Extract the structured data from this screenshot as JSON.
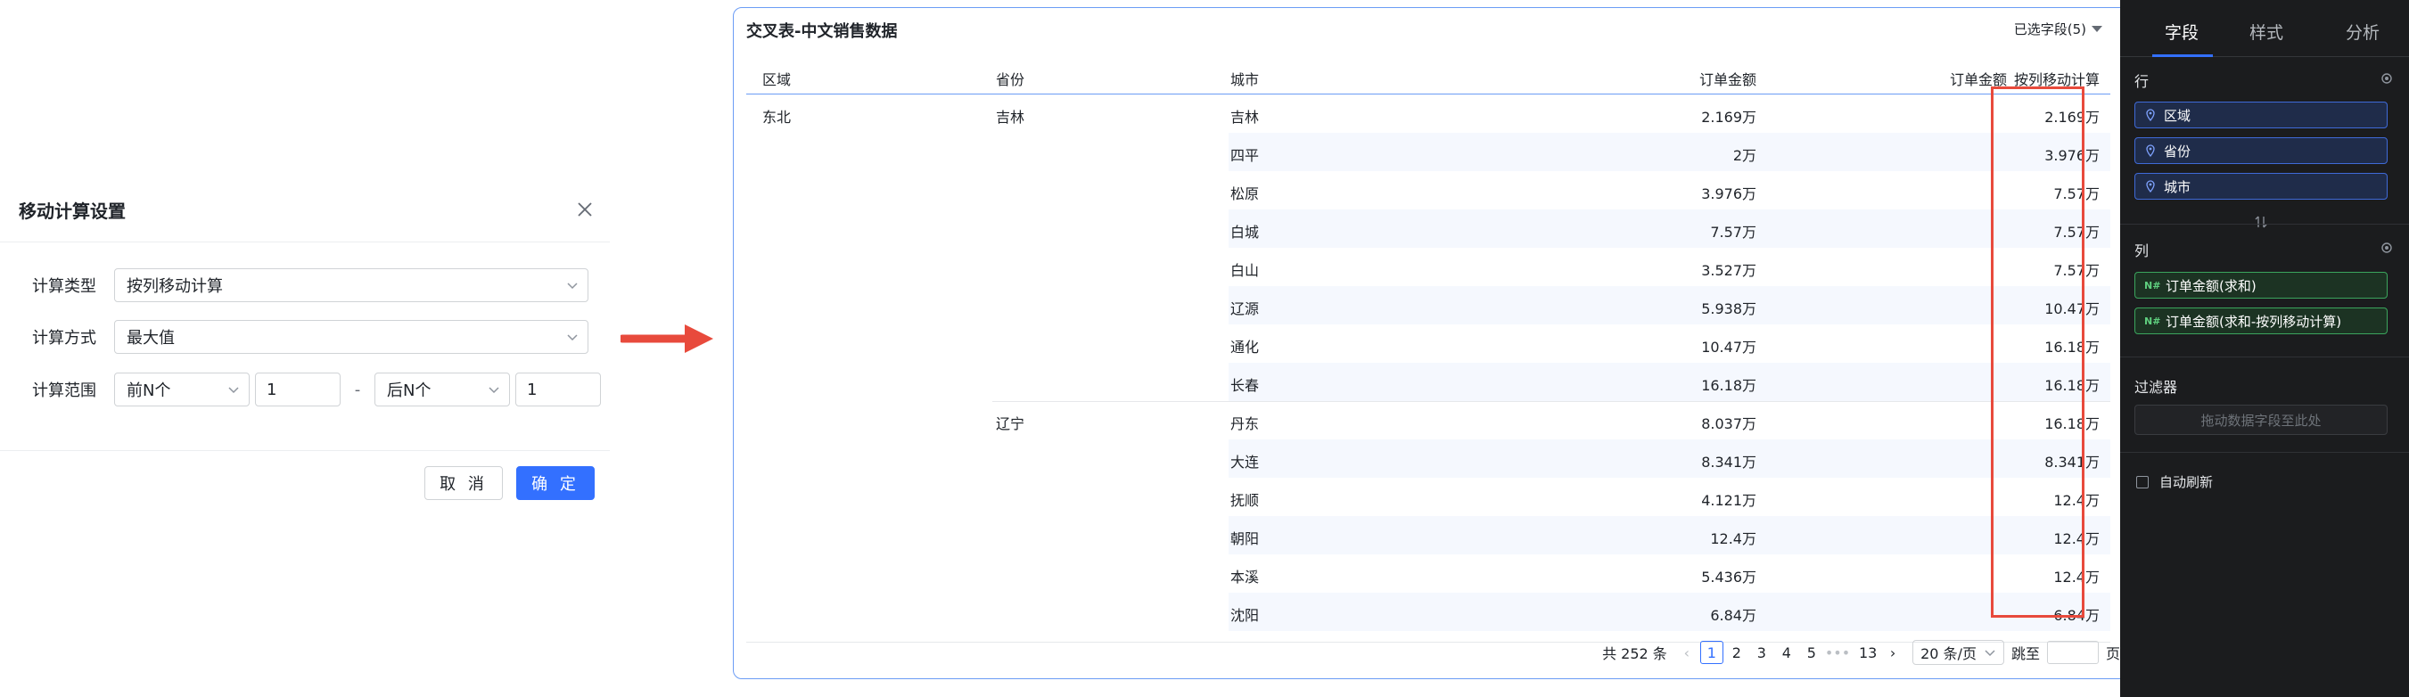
{
  "dialog": {
    "title": "移动计算设置",
    "calc_type_label": "计算类型",
    "calc_type_value": "按列移动计算",
    "calc_method_label": "计算方式",
    "calc_method_value": "最大值",
    "calc_range_label": "计算范围",
    "range_start_select": "前N个",
    "range_start_value": "1",
    "range_separator": "-",
    "range_end_select": "后N个",
    "range_end_value": "1",
    "cancel_label": "取 消",
    "ok_label": "确 定"
  },
  "table": {
    "title": "交叉表-中文销售数据",
    "fields_selected": "已选字段(5)",
    "headers": [
      "区域",
      "省份",
      "城市",
      "订单金额",
      "订单金额_按列移动计算"
    ],
    "region": "东北",
    "groups": [
      {
        "province": "吉林",
        "rows": [
          {
            "city": "吉林",
            "amount": "2.169万",
            "moving": "2.169万"
          },
          {
            "city": "四平",
            "amount": "2万",
            "moving": "3.976万"
          },
          {
            "city": "松原",
            "amount": "3.976万",
            "moving": "7.57万"
          },
          {
            "city": "白城",
            "amount": "7.57万",
            "moving": "7.57万"
          },
          {
            "city": "白山",
            "amount": "3.527万",
            "moving": "7.57万"
          },
          {
            "city": "辽源",
            "amount": "5.938万",
            "moving": "10.47万"
          },
          {
            "city": "通化",
            "amount": "10.47万",
            "moving": "16.18万"
          },
          {
            "city": "长春",
            "amount": "16.18万",
            "moving": "16.18万"
          }
        ]
      },
      {
        "province": "辽宁",
        "rows": [
          {
            "city": "丹东",
            "amount": "8.037万",
            "moving": "16.18万"
          },
          {
            "city": "大连",
            "amount": "8.341万",
            "moving": "8.341万"
          },
          {
            "city": "抚顺",
            "amount": "4.121万",
            "moving": "12.4万"
          },
          {
            "city": "朝阳",
            "amount": "12.4万",
            "moving": "12.4万"
          },
          {
            "city": "本溪",
            "amount": "5.436万",
            "moving": "12.4万"
          },
          {
            "city": "沈阳",
            "amount": "6.84万",
            "moving": "6.84万"
          }
        ]
      }
    ],
    "pager": {
      "total": "共 252 条",
      "pages": [
        "1",
        "2",
        "3",
        "4",
        "5"
      ],
      "ellipsis": "•••",
      "last_page": "13",
      "page_size": "20 条/页",
      "jump_label": "跳至",
      "page_suffix": "页"
    }
  },
  "panel": {
    "tabs": [
      "字段",
      "样式",
      "分析"
    ],
    "rows_title": "行",
    "row_fields": [
      "区域",
      "省份",
      "城市"
    ],
    "cols_title": "列",
    "col_fields": [
      "订单金额(求和)",
      "订单金额(求和-按列移动计算)"
    ],
    "measure_symbol": "N#",
    "filter_title": "过滤器",
    "filter_placeholder": "拖动数据字段至此处",
    "auto_refresh_label": "自动刷新"
  },
  "colors": {
    "accent": "#3370ff",
    "highlight": "#e84a3c",
    "arrow": "#e84a3c",
    "panel_bg": "#1b1c1e",
    "dimension_chip": "#3f6ad8",
    "measure_chip": "#3ba55d"
  }
}
